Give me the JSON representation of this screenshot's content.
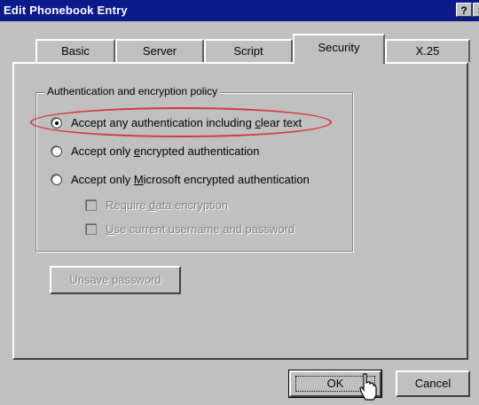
{
  "window": {
    "title": "Edit Phonebook Entry",
    "help_glyph": "?",
    "close_glyph": "×"
  },
  "tabs": [
    {
      "label": "Basic",
      "active": false
    },
    {
      "label": "Server",
      "active": false
    },
    {
      "label": "Script",
      "active": false
    },
    {
      "label": "Security",
      "active": true
    },
    {
      "label": "X.25",
      "active": false
    }
  ],
  "group": {
    "label": "Authentication and encryption policy"
  },
  "options": {
    "opt1": {
      "prefix": "Accept any authentication including ",
      "accel": "c",
      "suffix": "lear text",
      "selected": true
    },
    "opt2": {
      "prefix": "Accept only ",
      "accel": "e",
      "suffix": "ncrypted authentication",
      "selected": false
    },
    "opt3": {
      "prefix": "Accept only ",
      "accel": "M",
      "suffix": "icrosoft encrypted authentication",
      "selected": false
    }
  },
  "checkboxes": {
    "require": {
      "prefix": "Require ",
      "accel": "d",
      "suffix": "ata encryption",
      "enabled": false
    },
    "current": {
      "prefix": "",
      "accel": "U",
      "suffix": "se current username and password",
      "enabled": false
    }
  },
  "buttons": {
    "unsave": "Unsave password",
    "ok": "OK",
    "cancel": "Cancel"
  },
  "colors": {
    "title_bar": "#0a1a8c",
    "face": "#c0c0c0",
    "annotation": "#d8343a"
  }
}
